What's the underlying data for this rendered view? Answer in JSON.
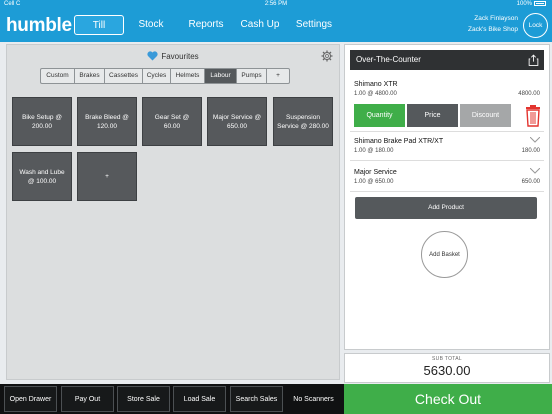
{
  "status_bar": {
    "carrier": "Cell C",
    "time": "2:56 PM",
    "battery": "100%"
  },
  "nav": {
    "logo": "humble",
    "tabs": [
      "Till",
      "Stock",
      "Reports",
      "Cash Up",
      "Settings"
    ],
    "active_tab": "Till",
    "user_name": "Zack Finlayson",
    "shop_name": "Zack's Bike Shop",
    "lock_label": "Lock"
  },
  "favourites": {
    "title": "Favourites",
    "categories": [
      "Custom",
      "Brakes",
      "Cassettes",
      "Cycles",
      "Helmets",
      "Labour",
      "Pumps",
      "+"
    ],
    "active_category": "Labour",
    "tiles": [
      "Bike Setup @ 200.00",
      "Brake Bleed @ 120.00",
      "Gear Set @ 60.00",
      "Major Service @ 650.00",
      "Suspension Service @ 280.00",
      "Wash and Lube @ 100.00",
      "+"
    ]
  },
  "order": {
    "title": "Over-The-Counter",
    "items": [
      {
        "name": "Shimano XTR",
        "qty": "1.00 @ 4800.00",
        "total": "4800.00"
      },
      {
        "name": "Shimano Brake Pad XTR/XT",
        "qty": "1.00 @ 180.00",
        "total": "180.00"
      },
      {
        "name": "Major Service",
        "qty": "1.00 @ 650.00",
        "total": "650.00"
      }
    ],
    "actions": [
      "Quantity",
      "Price",
      "Discount"
    ],
    "add_product": "Add Product",
    "add_basket": "Add Basket"
  },
  "subtotal": {
    "label": "SUB TOTAL",
    "value": "5630.00"
  },
  "bottom": {
    "buttons": [
      "Open Drawer",
      "Pay Out",
      "Store Sale",
      "Load Sale",
      "Search Sales",
      "No Scanners"
    ],
    "checkout": "Check Out"
  },
  "colors": {
    "brand": "#1d9cd6",
    "checkout": "#3fae49",
    "quantity": "#3fae49",
    "price": "#55595c",
    "discount": "#a5a7a8",
    "trash": "#e3342f"
  }
}
